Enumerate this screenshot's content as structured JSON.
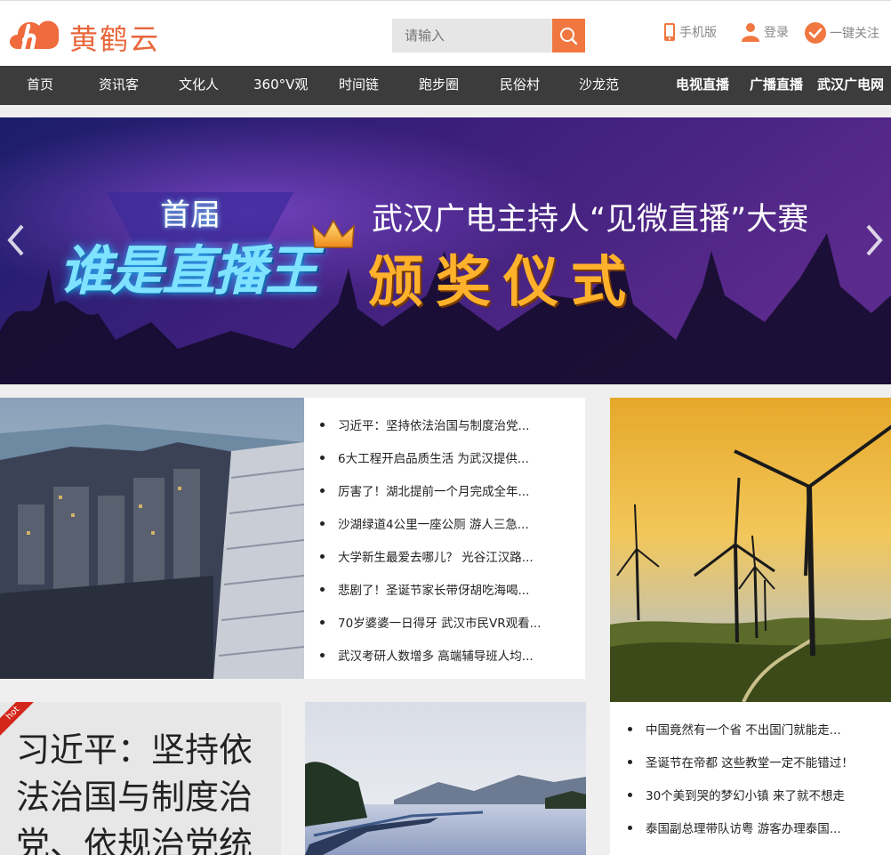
{
  "header": {
    "logo_text": "黄鹤云",
    "search_placeholder": "请输入",
    "links": {
      "mobile": "手机版",
      "login": "登录",
      "follow": "一键关注"
    }
  },
  "nav": {
    "items": [
      "首页",
      "资讯客",
      "文化人",
      "360°V观",
      "时间链",
      "跑步圈",
      "民俗村",
      "沙龙范"
    ],
    "right_items": [
      "电视直播",
      "广播直播",
      "武汉广电网"
    ]
  },
  "banner": {
    "badge_top": "首届",
    "badge_main": "谁是直播王",
    "headline": "武汉广电主持人“见微直播”大赛",
    "subheadline": "颁奖仪式"
  },
  "news_list_1": [
    "习近平：坚持依法治国与制度治党...",
    "6大工程开启品质生活 为武汉提供...",
    "厉害了！湖北提前一个月完成全年...",
    "沙湖绿道4公里一座公厕 游人三急...",
    "大学新生最爱去哪儿？ 光谷江汉路...",
    "悲剧了！圣诞节家长带伢胡吃海喝...",
    "70岁婆婆一日得牙 武汉市民VR观看...",
    "武汉考研人数增多 高端辅导班人均..."
  ],
  "news_list_2": [
    "中国竟然有一个省 不出国门就能走...",
    "圣诞节在帝都 这些教堂一定不能错过！",
    "30个美到哭的梦幻小镇 来了就不想走",
    "泰国副总理带队访粤 游客办理泰国..."
  ],
  "feature": {
    "badge": "hot",
    "text": "习近平：坚持依法治国与制度治党、依规治党统"
  },
  "colors": {
    "accent": "#f07740",
    "nav_bg": "#3c3c3c",
    "hot": "#d4271c"
  }
}
